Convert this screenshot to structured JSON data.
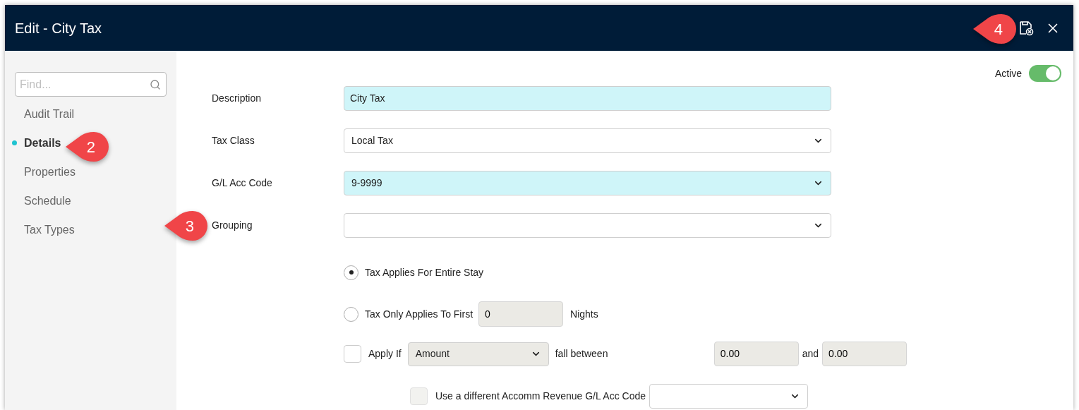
{
  "window": {
    "title": "Edit - City Tax"
  },
  "sidebar": {
    "search": {
      "placeholder": "Find..."
    },
    "items": [
      {
        "label": "Audit Trail",
        "selected": false
      },
      {
        "label": "Details",
        "selected": true
      },
      {
        "label": "Properties",
        "selected": false
      },
      {
        "label": "Schedule",
        "selected": false
      },
      {
        "label": "Tax Types",
        "selected": false
      }
    ]
  },
  "active": {
    "label": "Active",
    "on": true
  },
  "fields": [
    {
      "label": "Description",
      "kind": "text",
      "value": "City Tax",
      "highlighted": true
    },
    {
      "label": "Tax Class",
      "kind": "select",
      "value": "Local Tax",
      "highlighted": false
    },
    {
      "label": "G/L Acc Code",
      "kind": "select",
      "value": "9-9999",
      "highlighted": true
    },
    {
      "label": "Grouping",
      "kind": "select",
      "highlighted": false
    }
  ],
  "stay_options": [
    {
      "label": "Tax Applies For Entire Stay",
      "selected": true
    },
    {
      "label": "Tax Only Applies To First",
      "selected": false,
      "nights": "0",
      "suffix": "Nights"
    }
  ],
  "apply_if": {
    "checked": false,
    "label": "Apply If",
    "basis": "Amount",
    "text": "fall between",
    "from": "0.00",
    "joiner": "and",
    "to": "0.00"
  },
  "revenue_code": {
    "checked": false,
    "disabled": true,
    "label": "Use a different Accomm Revenue G/L Acc Code"
  },
  "callouts": [
    {
      "number": "2"
    },
    {
      "number": "3"
    },
    {
      "number": "4"
    }
  ]
}
